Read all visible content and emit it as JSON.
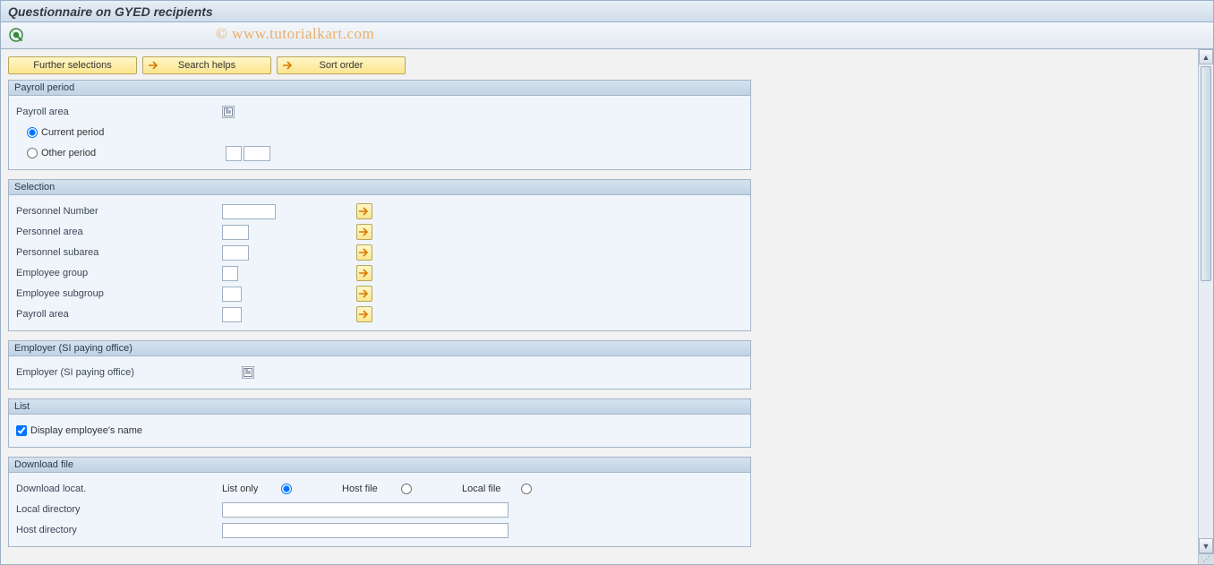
{
  "title": "Questionnaire on GYED recipients",
  "watermark": "© www.tutorialkart.com",
  "toolbar_buttons": {
    "further_selections": "Further selections",
    "search_helps": "Search helps",
    "sort_order": "Sort order"
  },
  "groups": {
    "payroll_period": {
      "title": "Payroll period",
      "payroll_area_label": "Payroll area",
      "current_period_label": "Current period",
      "other_period_label": "Other period"
    },
    "selection": {
      "title": "Selection",
      "rows": [
        {
          "label": "Personnel Number"
        },
        {
          "label": "Personnel area"
        },
        {
          "label": "Personnel subarea"
        },
        {
          "label": "Employee group"
        },
        {
          "label": "Employee subgroup"
        },
        {
          "label": "Payroll area"
        }
      ]
    },
    "employer": {
      "title": "Employer (SI paying office)",
      "label": "Employer (SI paying office)"
    },
    "list": {
      "title": "List",
      "display_name_label": "Display employee's name"
    },
    "download": {
      "title": "Download file",
      "locat_label": "Download locat.",
      "list_only": "List only",
      "host_file": "Host file",
      "local_file": "Local file",
      "local_dir": "Local directory",
      "host_dir": "Host directory"
    }
  }
}
